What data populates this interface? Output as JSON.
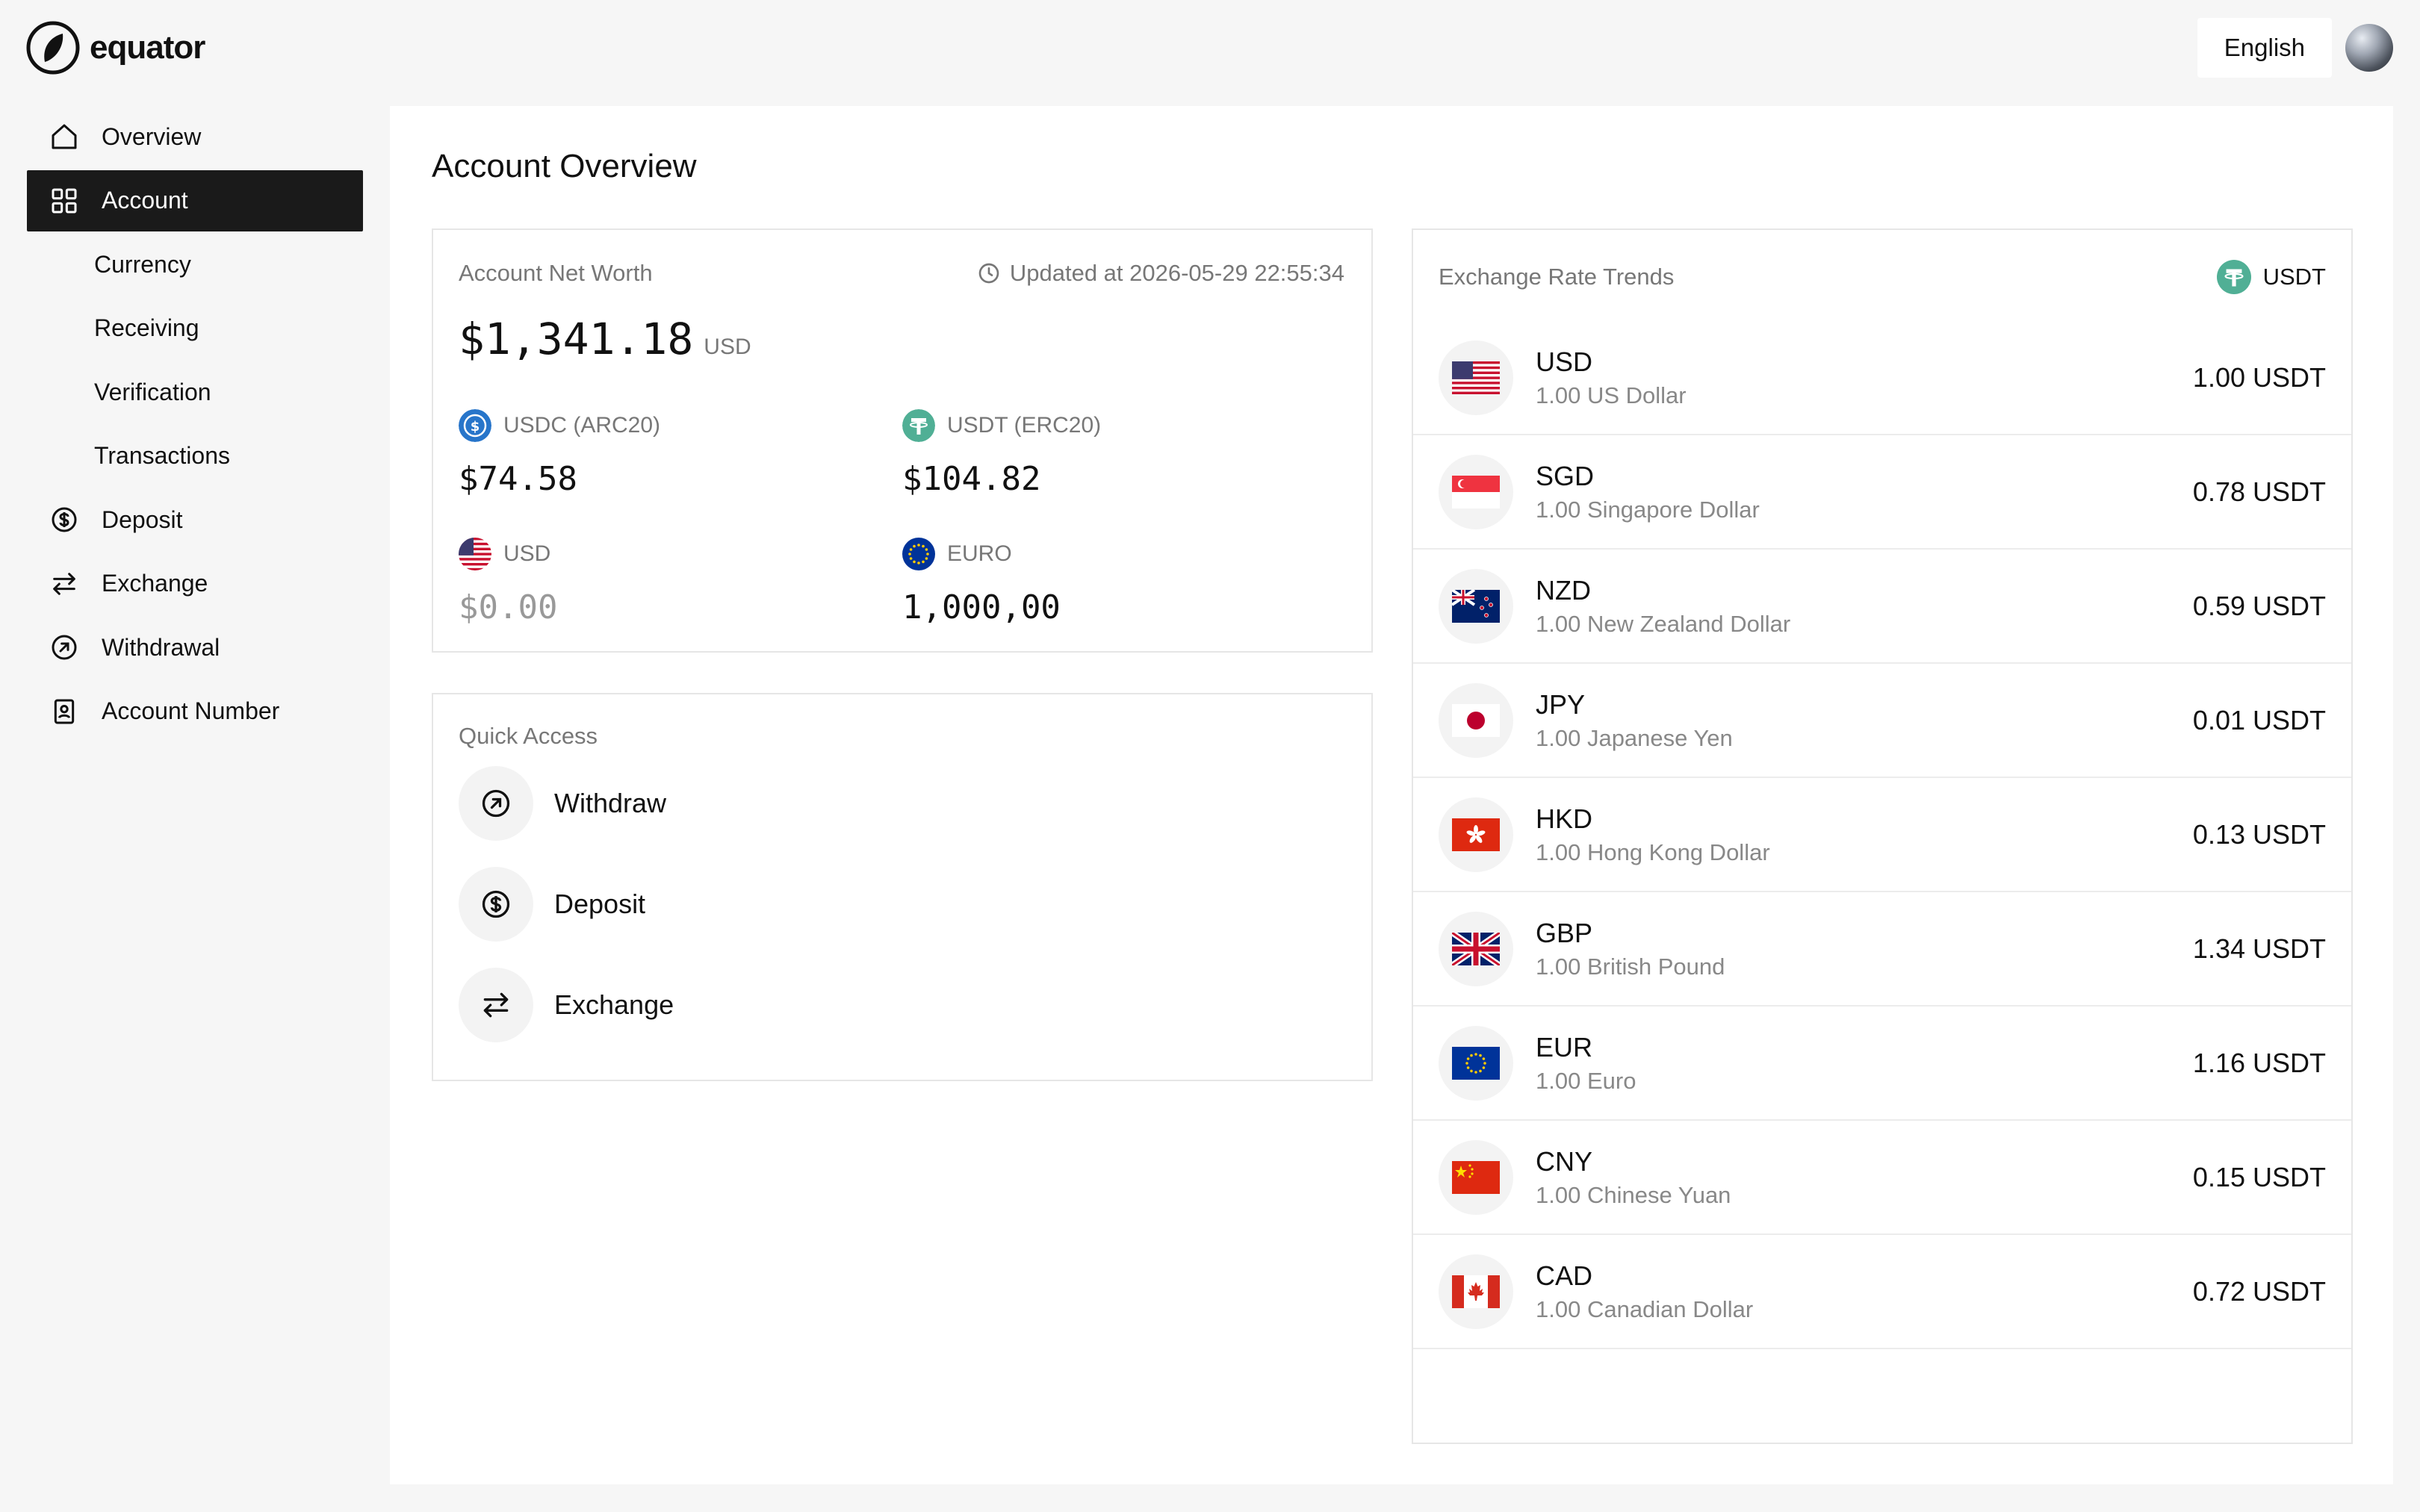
{
  "app": {
    "name": "equator"
  },
  "topbar": {
    "language": "English"
  },
  "sidebar": {
    "items": [
      {
        "label": "Overview",
        "icon": "home-icon"
      },
      {
        "label": "Account",
        "icon": "grid-icon",
        "active": true
      },
      {
        "label": "Currency"
      },
      {
        "label": "Receiving"
      },
      {
        "label": "Verification"
      },
      {
        "label": "Transactions"
      },
      {
        "label": "Deposit",
        "icon": "dollar-circle-icon"
      },
      {
        "label": "Exchange",
        "icon": "swap-icon"
      },
      {
        "label": "Withdrawal",
        "icon": "arrow-up-right-circle-icon"
      },
      {
        "label": "Account Number",
        "icon": "id-badge-icon"
      }
    ]
  },
  "main": {
    "title": "Account Overview",
    "net_worth": {
      "label": "Account Net Worth",
      "updated": "Updated at 2026-05-29 22:55:34",
      "amount": "$1,341.18",
      "currency": "USD",
      "assets": [
        {
          "name": "USDC (ARC20)",
          "value": "$74.58",
          "icon": "usdc-icon"
        },
        {
          "name": "USDT (ERC20)",
          "value": "$104.82",
          "icon": "usdt-icon"
        },
        {
          "name": "USD",
          "value": "$0.00",
          "icon": "us-flag-icon"
        },
        {
          "name": "EURO",
          "value": "1,000,00",
          "icon": "eu-flag-icon"
        }
      ]
    },
    "quick_access": {
      "label": "Quick Access",
      "items": [
        {
          "label": "Withdraw",
          "icon": "arrow-up-right-circle-icon"
        },
        {
          "label": "Deposit",
          "icon": "dollar-circle-icon"
        },
        {
          "label": "Exchange",
          "icon": "swap-icon"
        }
      ]
    },
    "exchange_rates": {
      "label": "Exchange Rate Trends",
      "base": "USDT",
      "rows": [
        {
          "code": "USD",
          "name": "1.00 US Dollar",
          "rate": "1.00 USDT"
        },
        {
          "code": "SGD",
          "name": "1.00 Singapore Dollar",
          "rate": "0.78 USDT"
        },
        {
          "code": "NZD",
          "name": "1.00 New Zealand Dollar",
          "rate": "0.59 USDT"
        },
        {
          "code": "JPY",
          "name": "1.00 Japanese Yen",
          "rate": "0.01 USDT"
        },
        {
          "code": "HKD",
          "name": "1.00 Hong Kong Dollar",
          "rate": "0.13 USDT"
        },
        {
          "code": "GBP",
          "name": "1.00 British Pound",
          "rate": "1.34 USDT"
        },
        {
          "code": "EUR",
          "name": "1.00 Euro",
          "rate": "1.16 USDT"
        },
        {
          "code": "CNY",
          "name": "1.00 Chinese Yuan",
          "rate": "0.15 USDT"
        },
        {
          "code": "CAD",
          "name": "1.00 Canadian Dollar",
          "rate": "0.72 USDT"
        }
      ]
    }
  },
  "colors": {
    "active_nav_bg": "#1a1a1a",
    "usdt_green": "#50af95",
    "usdc_blue": "#2775ca",
    "page_bg": "#f6f6f6"
  }
}
